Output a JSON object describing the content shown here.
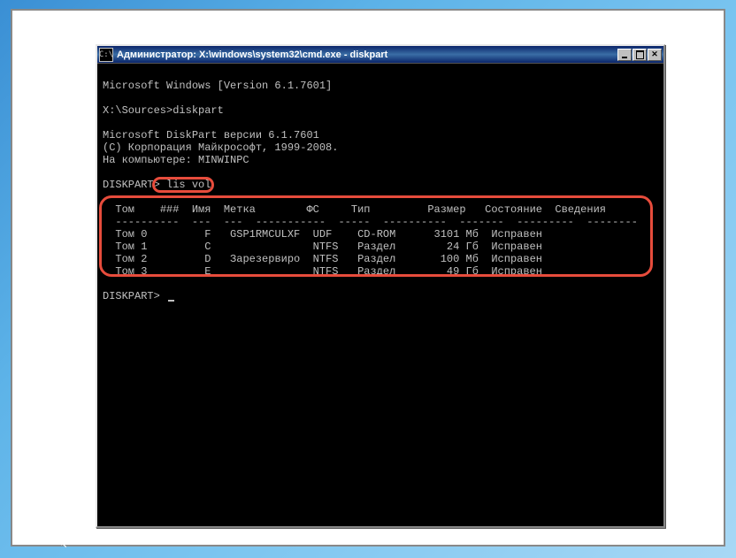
{
  "window": {
    "title": "Администратор: X:\\windows\\system32\\cmd.exe - diskpart"
  },
  "console": {
    "line_version": "Microsoft Windows [Version 6.1.7601]",
    "line_prompt1": "X:\\Sources>diskpart",
    "line_dp_version": "Microsoft DiskPart версии 6.1.7601",
    "line_copyright": "(C) Корпорация Майкрософт, 1999-2008.",
    "line_computer": "На компьютере: MINWINPC",
    "diskpart_prompt": "DISKPART>",
    "command": "lis vol",
    "headers": {
      "tom": "Том",
      "num": "###",
      "name": "Имя",
      "label": "Метка",
      "fs": "ФС",
      "type": "Тип",
      "size": "Размер",
      "status": "Состояние",
      "info": "Сведения"
    },
    "rows": [
      {
        "tom": "Том 0",
        "name": "F",
        "label": "GSP1RMCULXF",
        "fs": "UDF",
        "type": "CD-ROM",
        "size": "3101 Мб",
        "status": "Исправен"
      },
      {
        "tom": "Том 1",
        "name": "C",
        "label": "",
        "fs": "NTFS",
        "type": "Раздел",
        "size": "24 Гб",
        "status": "Исправен"
      },
      {
        "tom": "Том 2",
        "name": "D",
        "label": "Зарезервиро",
        "fs": "NTFS",
        "type": "Раздел",
        "size": "100 Мб",
        "status": "Исправен"
      },
      {
        "tom": "Том 3",
        "name": "E",
        "label": "",
        "fs": "NTFS",
        "type": "Раздел",
        "size": "49 Гб",
        "status": "Исправен"
      }
    ]
  }
}
